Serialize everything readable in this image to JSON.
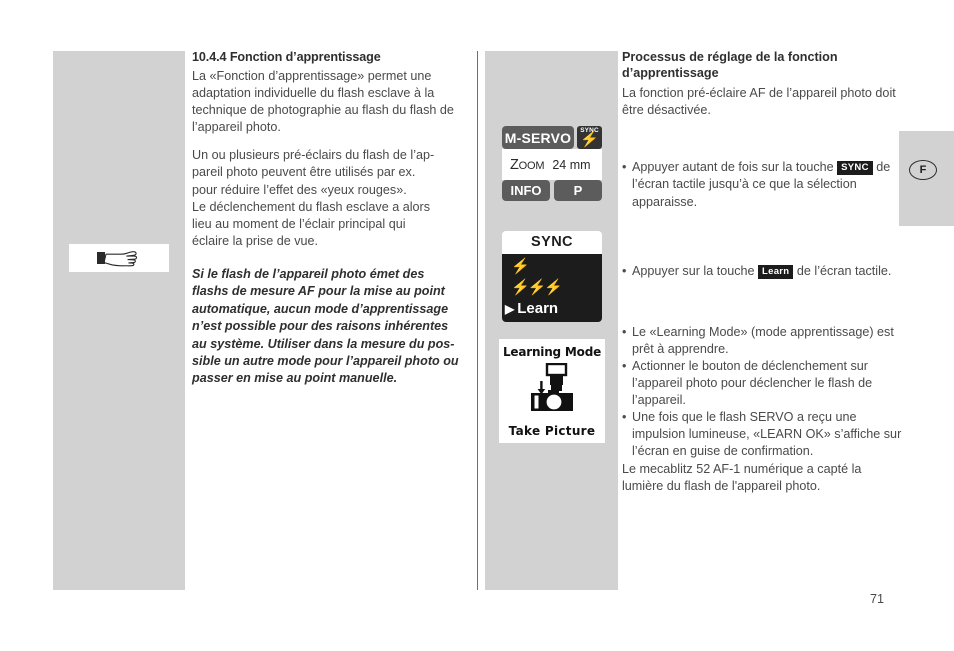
{
  "page": {
    "number": "71",
    "language_tab": "F"
  },
  "left_panel": {
    "hand_icon": "pointing-hand-icon"
  },
  "column_one": {
    "heading": "10.4.4 Fonction d’apprentissage",
    "paragraphs": [
      "La «Fonction d’apprentissage» permet une adaptation individuelle du flash esclave à la technique de photographie au flash du flash de l’appareil photo.",
      "Un ou plusieurs pré-éclairs du flash de l’ap-\npareil photo peuvent être utilisés par ex.\npour réduire l’effet des «yeux rouges».\nLe déclenchement du flash esclave a alors\nlieu au moment de l’éclair principal qui\néclaire la prise de vue."
    ],
    "note": "Si le flash de l’appareil photo émet des flashs de mesure AF pour la mise au point automatique, aucun mode d’apprentissage n’est possible pour des raisons inhérentes au système. Utiliser dans la mesure du pos-sible un autre mode pour l’appareil photo ou passer en mise au point manuelle."
  },
  "device_displays": {
    "display_one": {
      "mode_label": "M-SERVO",
      "sync_tile_word": "SYNC",
      "sync_tile_glyph": "flash-bolt-icon",
      "zoom_label": "Zoom",
      "zoom_value": "24 mm",
      "info_button": "INFO",
      "program_button": "P"
    },
    "display_two": {
      "header": "SYNC",
      "items": [
        {
          "glyph": "flash-bolt-icon",
          "label": "",
          "selected": false
        },
        {
          "glyph": "multi-flash-icon",
          "label": "",
          "selected": false
        },
        {
          "glyph": "",
          "label": "Learn",
          "selected": true
        }
      ]
    },
    "display_three": {
      "title": "Learning Mode",
      "art": "camera-with-flash-icon",
      "footer": "Take Picture"
    }
  },
  "column_two": {
    "heading": "Processus de réglage de la fonction d’apprentissage",
    "intro": "La fonction pré-éclaire AF de l’appareil photo doit être désactivée.",
    "bullet_one_prefix": "Appuyer autant de fois sur la touche ",
    "bullet_one_badge": "SYNC",
    "bullet_one_suffix": " de l’écran tactile jusqu’à ce que la sélection apparaisse.",
    "bullet_two_prefix": "Appuyer sur la touche ",
    "bullet_two_badge": "Learn",
    "bullet_two_suffix": " de l’écran tactile.",
    "bullet_three": "Le «Learning Mode» (mode apprentissage) est prêt à apprendre.",
    "bullet_four": "Actionner le bouton de déclenchement sur l’appareil photo pour déclencher le flash de l’appareil.",
    "bullet_four_cont": "Une fois que le flash SERVO a reçu une impulsion lumineuse, «LEARN OK» s’affiche sur l’écran en guise de confirmation.",
    "closing": "Le mecablitz 52 AF-1 numérique a capté la lumière du flash de l'appareil photo."
  },
  "colors": {
    "panel_gray": "#d2d2d2",
    "dark_ui": "#1c1c1c",
    "mid_gray_button": "#5c5c5c",
    "text": "#4a4a4a"
  }
}
